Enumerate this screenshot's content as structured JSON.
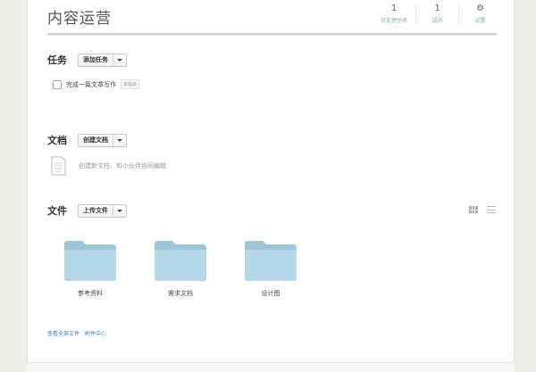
{
  "header": {
    "title": "内容运营",
    "stats": [
      {
        "value": "1",
        "label": "待处理任务"
      },
      {
        "value": "1",
        "label": "成员"
      }
    ],
    "settings_label": "设置"
  },
  "tasks": {
    "title": "任务",
    "add_button": "添加任务",
    "items": [
      {
        "label": "完成一篇文章写作",
        "badge": "未指派",
        "checked": false
      }
    ]
  },
  "docs": {
    "title": "文档",
    "create_button": "创建文档",
    "hint": "创建新文档，和小伙伴协同编辑",
    "icon": "document-icon"
  },
  "files": {
    "title": "文件",
    "upload_button": "上传文件",
    "folders": [
      {
        "name": "参考资料"
      },
      {
        "name": "需求文档"
      },
      {
        "name": "设计图"
      }
    ],
    "view_icons": [
      "grid-view-icon",
      "list-view-icon"
    ]
  },
  "footer": {
    "all_files": "查看全部文件",
    "attachments": "附件中心"
  },
  "colors": {
    "folder": "#a9d0e2",
    "link": "#3a7fb5"
  }
}
